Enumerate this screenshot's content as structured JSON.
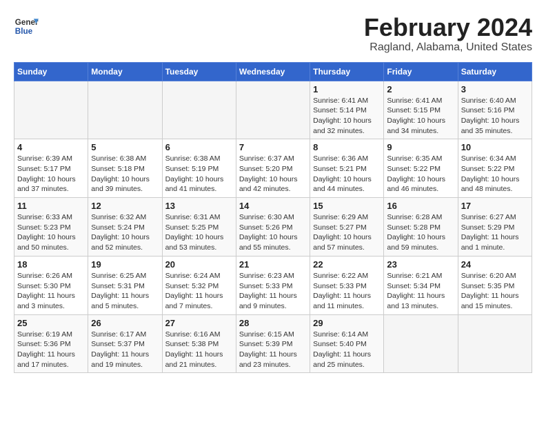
{
  "header": {
    "logo_line1": "General",
    "logo_line2": "Blue",
    "title": "February 2024",
    "subtitle": "Ragland, Alabama, United States"
  },
  "weekdays": [
    "Sunday",
    "Monday",
    "Tuesday",
    "Wednesday",
    "Thursday",
    "Friday",
    "Saturday"
  ],
  "weeks": [
    [
      {
        "day": "",
        "info": ""
      },
      {
        "day": "",
        "info": ""
      },
      {
        "day": "",
        "info": ""
      },
      {
        "day": "",
        "info": ""
      },
      {
        "day": "1",
        "info": "Sunrise: 6:41 AM\nSunset: 5:14 PM\nDaylight: 10 hours\nand 32 minutes."
      },
      {
        "day": "2",
        "info": "Sunrise: 6:41 AM\nSunset: 5:15 PM\nDaylight: 10 hours\nand 34 minutes."
      },
      {
        "day": "3",
        "info": "Sunrise: 6:40 AM\nSunset: 5:16 PM\nDaylight: 10 hours\nand 35 minutes."
      }
    ],
    [
      {
        "day": "4",
        "info": "Sunrise: 6:39 AM\nSunset: 5:17 PM\nDaylight: 10 hours\nand 37 minutes."
      },
      {
        "day": "5",
        "info": "Sunrise: 6:38 AM\nSunset: 5:18 PM\nDaylight: 10 hours\nand 39 minutes."
      },
      {
        "day": "6",
        "info": "Sunrise: 6:38 AM\nSunset: 5:19 PM\nDaylight: 10 hours\nand 41 minutes."
      },
      {
        "day": "7",
        "info": "Sunrise: 6:37 AM\nSunset: 5:20 PM\nDaylight: 10 hours\nand 42 minutes."
      },
      {
        "day": "8",
        "info": "Sunrise: 6:36 AM\nSunset: 5:21 PM\nDaylight: 10 hours\nand 44 minutes."
      },
      {
        "day": "9",
        "info": "Sunrise: 6:35 AM\nSunset: 5:22 PM\nDaylight: 10 hours\nand 46 minutes."
      },
      {
        "day": "10",
        "info": "Sunrise: 6:34 AM\nSunset: 5:22 PM\nDaylight: 10 hours\nand 48 minutes."
      }
    ],
    [
      {
        "day": "11",
        "info": "Sunrise: 6:33 AM\nSunset: 5:23 PM\nDaylight: 10 hours\nand 50 minutes."
      },
      {
        "day": "12",
        "info": "Sunrise: 6:32 AM\nSunset: 5:24 PM\nDaylight: 10 hours\nand 52 minutes."
      },
      {
        "day": "13",
        "info": "Sunrise: 6:31 AM\nSunset: 5:25 PM\nDaylight: 10 hours\nand 53 minutes."
      },
      {
        "day": "14",
        "info": "Sunrise: 6:30 AM\nSunset: 5:26 PM\nDaylight: 10 hours\nand 55 minutes."
      },
      {
        "day": "15",
        "info": "Sunrise: 6:29 AM\nSunset: 5:27 PM\nDaylight: 10 hours\nand 57 minutes."
      },
      {
        "day": "16",
        "info": "Sunrise: 6:28 AM\nSunset: 5:28 PM\nDaylight: 10 hours\nand 59 minutes."
      },
      {
        "day": "17",
        "info": "Sunrise: 6:27 AM\nSunset: 5:29 PM\nDaylight: 11 hours\nand 1 minute."
      }
    ],
    [
      {
        "day": "18",
        "info": "Sunrise: 6:26 AM\nSunset: 5:30 PM\nDaylight: 11 hours\nand 3 minutes."
      },
      {
        "day": "19",
        "info": "Sunrise: 6:25 AM\nSunset: 5:31 PM\nDaylight: 11 hours\nand 5 minutes."
      },
      {
        "day": "20",
        "info": "Sunrise: 6:24 AM\nSunset: 5:32 PM\nDaylight: 11 hours\nand 7 minutes."
      },
      {
        "day": "21",
        "info": "Sunrise: 6:23 AM\nSunset: 5:33 PM\nDaylight: 11 hours\nand 9 minutes."
      },
      {
        "day": "22",
        "info": "Sunrise: 6:22 AM\nSunset: 5:33 PM\nDaylight: 11 hours\nand 11 minutes."
      },
      {
        "day": "23",
        "info": "Sunrise: 6:21 AM\nSunset: 5:34 PM\nDaylight: 11 hours\nand 13 minutes."
      },
      {
        "day": "24",
        "info": "Sunrise: 6:20 AM\nSunset: 5:35 PM\nDaylight: 11 hours\nand 15 minutes."
      }
    ],
    [
      {
        "day": "25",
        "info": "Sunrise: 6:19 AM\nSunset: 5:36 PM\nDaylight: 11 hours\nand 17 minutes."
      },
      {
        "day": "26",
        "info": "Sunrise: 6:17 AM\nSunset: 5:37 PM\nDaylight: 11 hours\nand 19 minutes."
      },
      {
        "day": "27",
        "info": "Sunrise: 6:16 AM\nSunset: 5:38 PM\nDaylight: 11 hours\nand 21 minutes."
      },
      {
        "day": "28",
        "info": "Sunrise: 6:15 AM\nSunset: 5:39 PM\nDaylight: 11 hours\nand 23 minutes."
      },
      {
        "day": "29",
        "info": "Sunrise: 6:14 AM\nSunset: 5:40 PM\nDaylight: 11 hours\nand 25 minutes."
      },
      {
        "day": "",
        "info": ""
      },
      {
        "day": "",
        "info": ""
      }
    ]
  ]
}
